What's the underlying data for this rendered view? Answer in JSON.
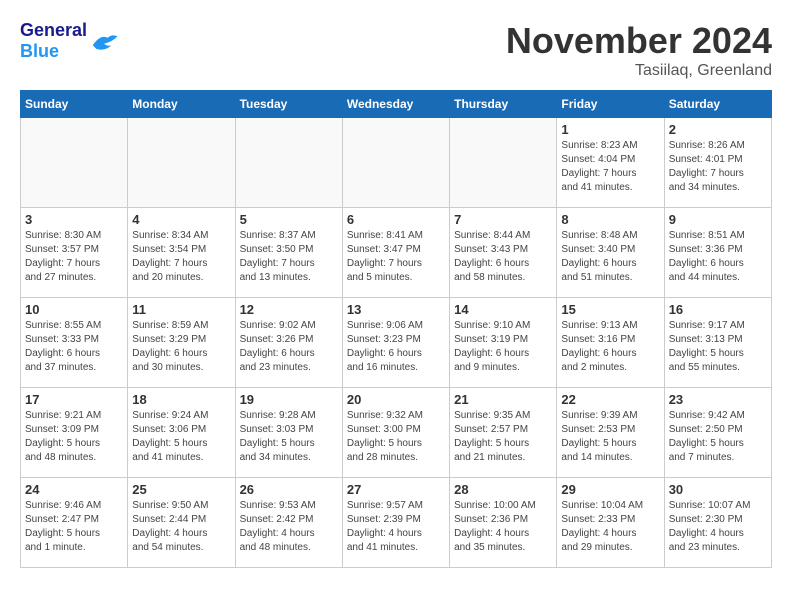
{
  "header": {
    "logo_general": "General",
    "logo_blue": "Blue",
    "month_title": "November 2024",
    "location": "Tasiilaq, Greenland"
  },
  "weekdays": [
    "Sunday",
    "Monday",
    "Tuesday",
    "Wednesday",
    "Thursday",
    "Friday",
    "Saturday"
  ],
  "weeks": [
    [
      {
        "day": "",
        "info": ""
      },
      {
        "day": "",
        "info": ""
      },
      {
        "day": "",
        "info": ""
      },
      {
        "day": "",
        "info": ""
      },
      {
        "day": "",
        "info": ""
      },
      {
        "day": "1",
        "info": "Sunrise: 8:23 AM\nSunset: 4:04 PM\nDaylight: 7 hours\nand 41 minutes."
      },
      {
        "day": "2",
        "info": "Sunrise: 8:26 AM\nSunset: 4:01 PM\nDaylight: 7 hours\nand 34 minutes."
      }
    ],
    [
      {
        "day": "3",
        "info": "Sunrise: 8:30 AM\nSunset: 3:57 PM\nDaylight: 7 hours\nand 27 minutes."
      },
      {
        "day": "4",
        "info": "Sunrise: 8:34 AM\nSunset: 3:54 PM\nDaylight: 7 hours\nand 20 minutes."
      },
      {
        "day": "5",
        "info": "Sunrise: 8:37 AM\nSunset: 3:50 PM\nDaylight: 7 hours\nand 13 minutes."
      },
      {
        "day": "6",
        "info": "Sunrise: 8:41 AM\nSunset: 3:47 PM\nDaylight: 7 hours\nand 5 minutes."
      },
      {
        "day": "7",
        "info": "Sunrise: 8:44 AM\nSunset: 3:43 PM\nDaylight: 6 hours\nand 58 minutes."
      },
      {
        "day": "8",
        "info": "Sunrise: 8:48 AM\nSunset: 3:40 PM\nDaylight: 6 hours\nand 51 minutes."
      },
      {
        "day": "9",
        "info": "Sunrise: 8:51 AM\nSunset: 3:36 PM\nDaylight: 6 hours\nand 44 minutes."
      }
    ],
    [
      {
        "day": "10",
        "info": "Sunrise: 8:55 AM\nSunset: 3:33 PM\nDaylight: 6 hours\nand 37 minutes."
      },
      {
        "day": "11",
        "info": "Sunrise: 8:59 AM\nSunset: 3:29 PM\nDaylight: 6 hours\nand 30 minutes."
      },
      {
        "day": "12",
        "info": "Sunrise: 9:02 AM\nSunset: 3:26 PM\nDaylight: 6 hours\nand 23 minutes."
      },
      {
        "day": "13",
        "info": "Sunrise: 9:06 AM\nSunset: 3:23 PM\nDaylight: 6 hours\nand 16 minutes."
      },
      {
        "day": "14",
        "info": "Sunrise: 9:10 AM\nSunset: 3:19 PM\nDaylight: 6 hours\nand 9 minutes."
      },
      {
        "day": "15",
        "info": "Sunrise: 9:13 AM\nSunset: 3:16 PM\nDaylight: 6 hours\nand 2 minutes."
      },
      {
        "day": "16",
        "info": "Sunrise: 9:17 AM\nSunset: 3:13 PM\nDaylight: 5 hours\nand 55 minutes."
      }
    ],
    [
      {
        "day": "17",
        "info": "Sunrise: 9:21 AM\nSunset: 3:09 PM\nDaylight: 5 hours\nand 48 minutes."
      },
      {
        "day": "18",
        "info": "Sunrise: 9:24 AM\nSunset: 3:06 PM\nDaylight: 5 hours\nand 41 minutes."
      },
      {
        "day": "19",
        "info": "Sunrise: 9:28 AM\nSunset: 3:03 PM\nDaylight: 5 hours\nand 34 minutes."
      },
      {
        "day": "20",
        "info": "Sunrise: 9:32 AM\nSunset: 3:00 PM\nDaylight: 5 hours\nand 28 minutes."
      },
      {
        "day": "21",
        "info": "Sunrise: 9:35 AM\nSunset: 2:57 PM\nDaylight: 5 hours\nand 21 minutes."
      },
      {
        "day": "22",
        "info": "Sunrise: 9:39 AM\nSunset: 2:53 PM\nDaylight: 5 hours\nand 14 minutes."
      },
      {
        "day": "23",
        "info": "Sunrise: 9:42 AM\nSunset: 2:50 PM\nDaylight: 5 hours\nand 7 minutes."
      }
    ],
    [
      {
        "day": "24",
        "info": "Sunrise: 9:46 AM\nSunset: 2:47 PM\nDaylight: 5 hours\nand 1 minute."
      },
      {
        "day": "25",
        "info": "Sunrise: 9:50 AM\nSunset: 2:44 PM\nDaylight: 4 hours\nand 54 minutes."
      },
      {
        "day": "26",
        "info": "Sunrise: 9:53 AM\nSunset: 2:42 PM\nDaylight: 4 hours\nand 48 minutes."
      },
      {
        "day": "27",
        "info": "Sunrise: 9:57 AM\nSunset: 2:39 PM\nDaylight: 4 hours\nand 41 minutes."
      },
      {
        "day": "28",
        "info": "Sunrise: 10:00 AM\nSunset: 2:36 PM\nDaylight: 4 hours\nand 35 minutes."
      },
      {
        "day": "29",
        "info": "Sunrise: 10:04 AM\nSunset: 2:33 PM\nDaylight: 4 hours\nand 29 minutes."
      },
      {
        "day": "30",
        "info": "Sunrise: 10:07 AM\nSunset: 2:30 PM\nDaylight: 4 hours\nand 23 minutes."
      }
    ]
  ]
}
